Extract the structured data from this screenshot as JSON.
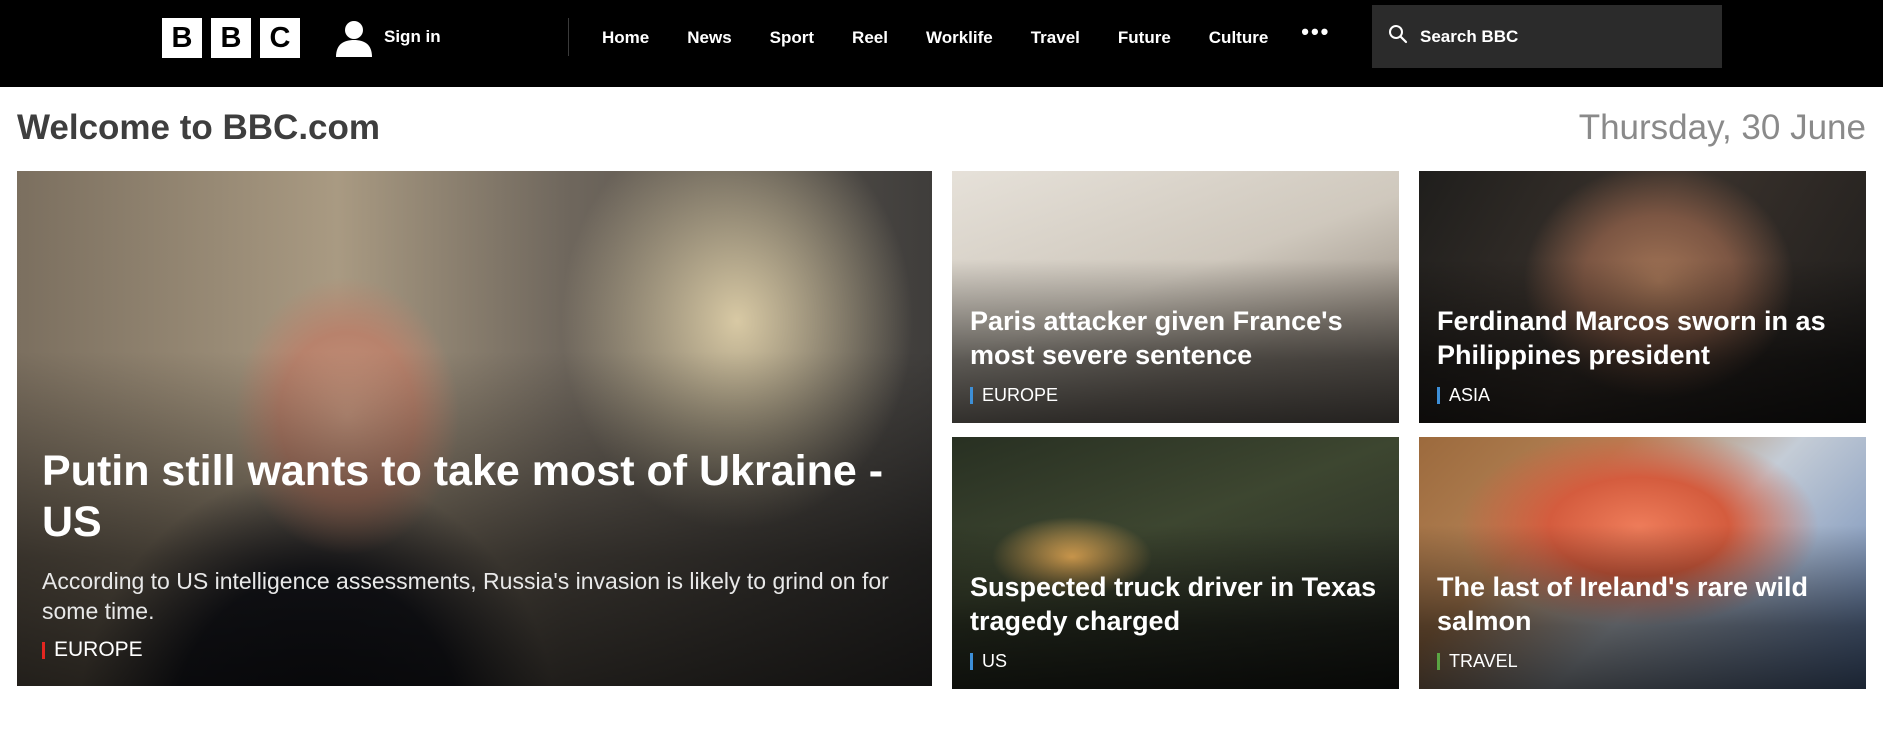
{
  "logo": {
    "letters": [
      "B",
      "B",
      "C"
    ]
  },
  "header": {
    "signin_label": "Sign in",
    "nav": [
      "Home",
      "News",
      "Sport",
      "Reel",
      "Worklife",
      "Travel",
      "Future",
      "Culture"
    ],
    "more_label": "•••",
    "search_placeholder": "Search BBC"
  },
  "main": {
    "welcome": "Welcome to BBC.com",
    "date": "Thursday, 30 June",
    "lead": {
      "title": "Putin still wants to take most of Ukraine - US",
      "summary": "According to US intelligence assessments, Russia's invasion is likely to grind on for some time.",
      "tag": "EUROPE",
      "tag_color": "#e52620"
    },
    "stories": [
      {
        "title": "Paris attacker given France's most severe sentence",
        "tag": "EUROPE",
        "tag_color": "#3d8fd7"
      },
      {
        "title": "Ferdinand Marcos sworn in as Philippines president",
        "tag": "ASIA",
        "tag_color": "#3d8fd7"
      },
      {
        "title": "Suspected truck driver in Texas tragedy charged",
        "tag": "US",
        "tag_color": "#3d8fd7"
      },
      {
        "title": "The last of Ireland's rare wild salmon",
        "tag": "TRAVEL",
        "tag_color": "#5aa543"
      }
    ]
  },
  "colors": {
    "topbar": "#000000",
    "search_bg": "#2b2b2b"
  }
}
